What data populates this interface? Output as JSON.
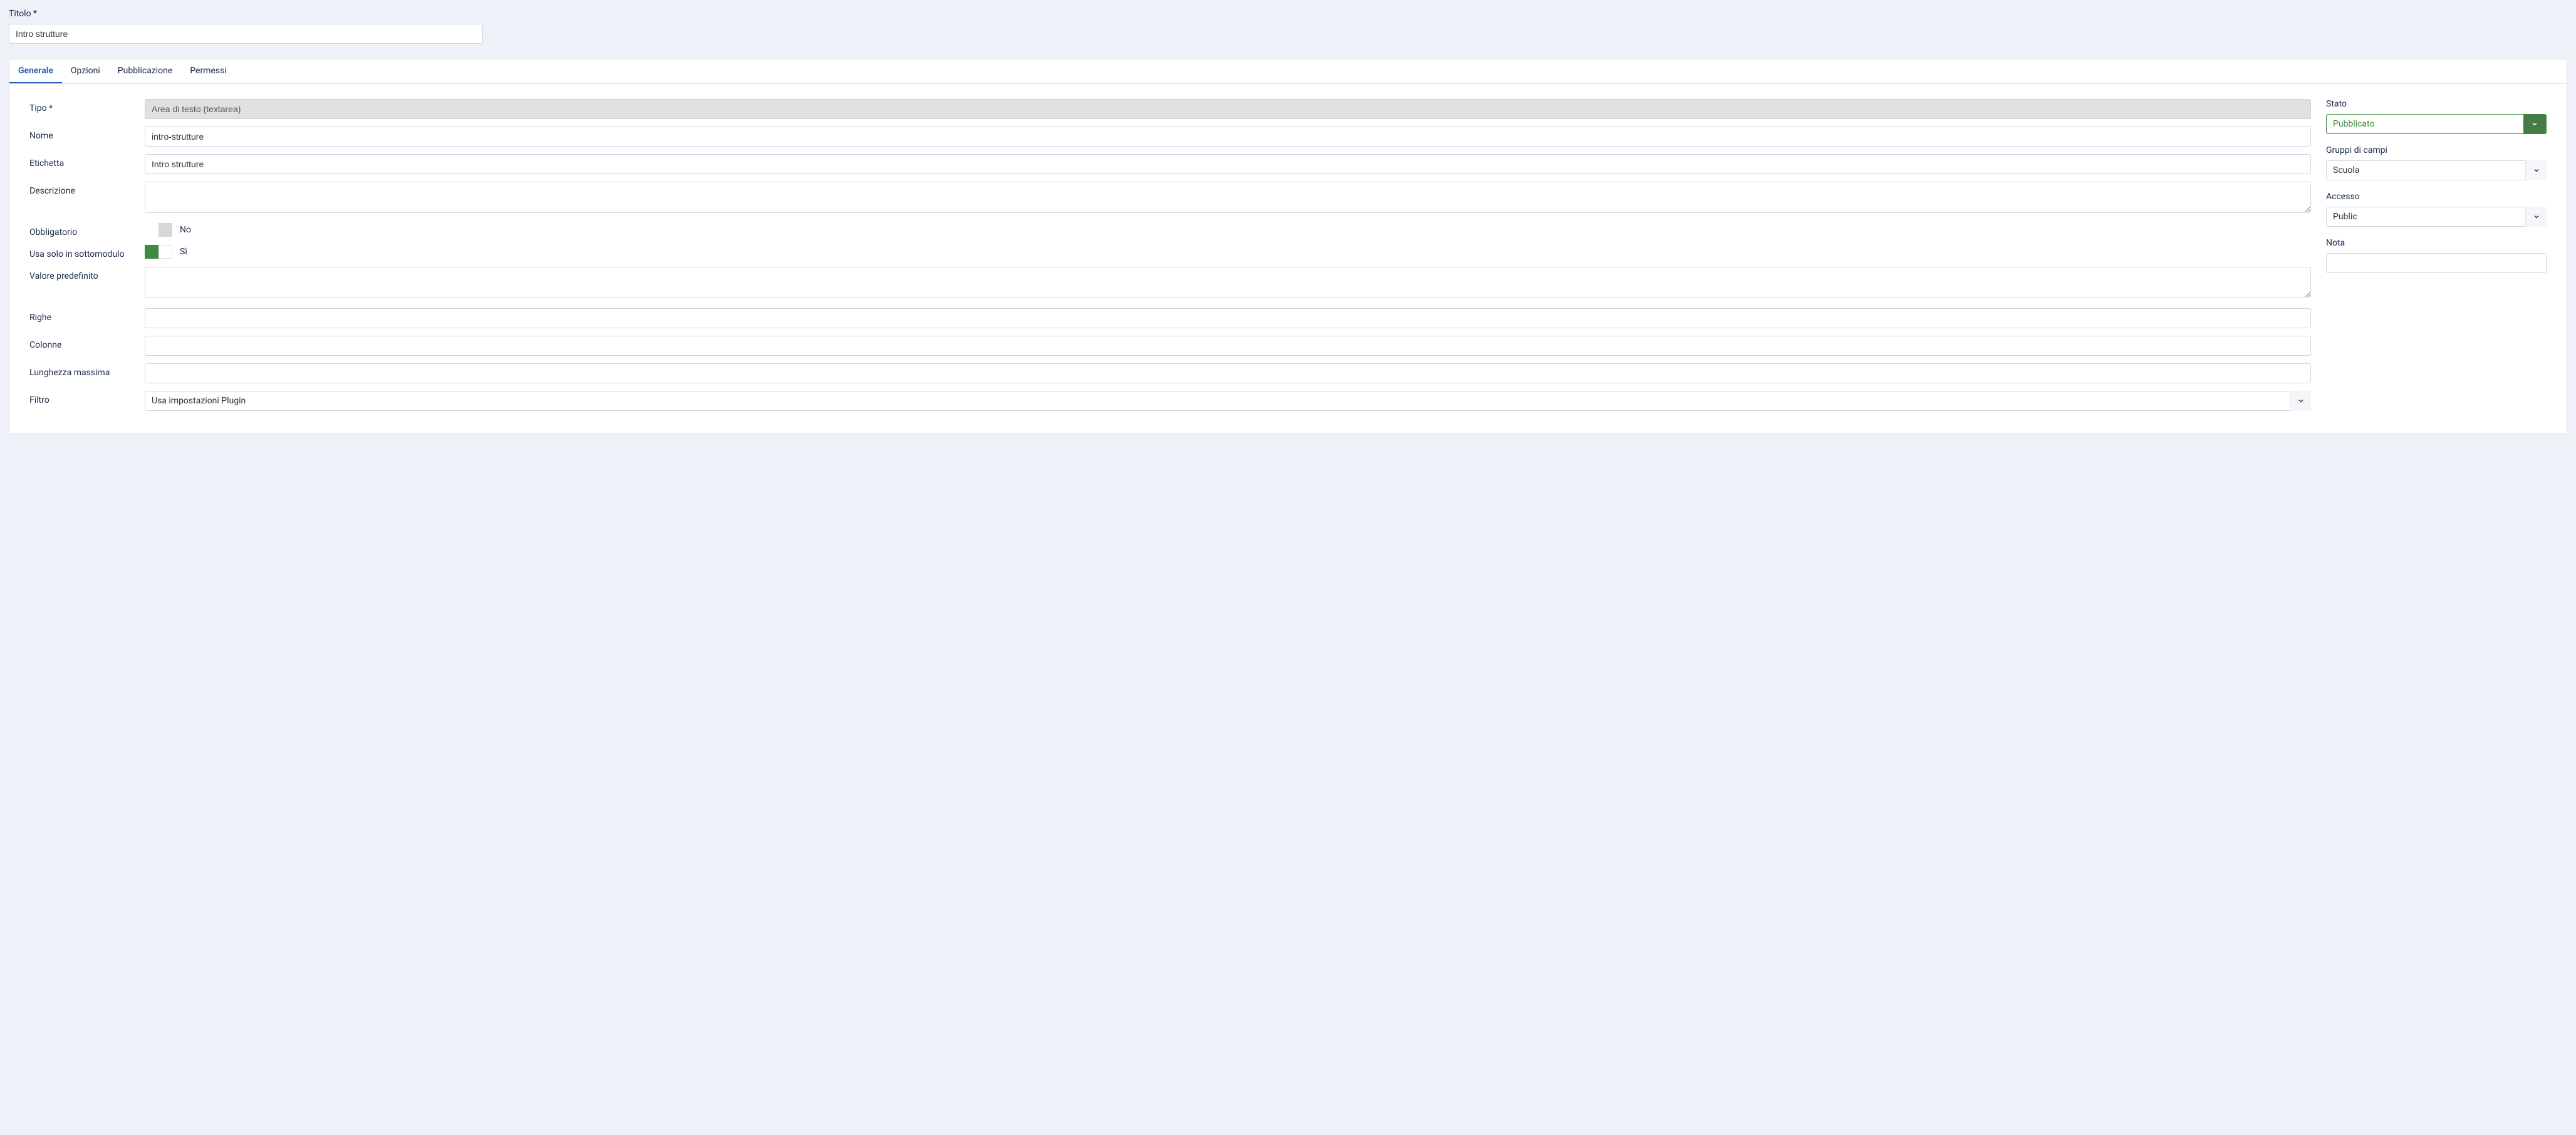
{
  "title": {
    "label": "Titolo *",
    "value": "Intro strutture"
  },
  "tabs": [
    {
      "label": "Generale",
      "active": true
    },
    {
      "label": "Opzioni",
      "active": false
    },
    {
      "label": "Pubblicazione",
      "active": false
    },
    {
      "label": "Permessi",
      "active": false
    }
  ],
  "fields": {
    "tipo": {
      "label": "Tipo *",
      "value": "Area di testo (textarea)"
    },
    "nome": {
      "label": "Nome",
      "value": "intro-strutture"
    },
    "etichetta": {
      "label": "Etichetta",
      "value": "Intro strutture"
    },
    "descrizione": {
      "label": "Descrizione",
      "value": ""
    },
    "obbligatorio": {
      "label": "Obbligatorio",
      "state_label": "No",
      "on": false
    },
    "sottomodulo": {
      "label": "Usa solo in sottomodulo",
      "state_label": "Sì",
      "on": true
    },
    "predefinito": {
      "label": "Valore predefinito",
      "value": ""
    },
    "righe": {
      "label": "Righe",
      "value": ""
    },
    "colonne": {
      "label": "Colonne",
      "value": ""
    },
    "lunghezza": {
      "label": "Lunghezza massima",
      "value": ""
    },
    "filtro": {
      "label": "Filtro",
      "value": "Usa impostazioni Plugin"
    }
  },
  "sidebar": {
    "stato": {
      "label": "Stato",
      "value": "Pubblicato"
    },
    "gruppi": {
      "label": "Gruppi di campi",
      "value": "Scuola"
    },
    "accesso": {
      "label": "Accesso",
      "value": "Public"
    },
    "nota": {
      "label": "Nota",
      "value": ""
    }
  }
}
